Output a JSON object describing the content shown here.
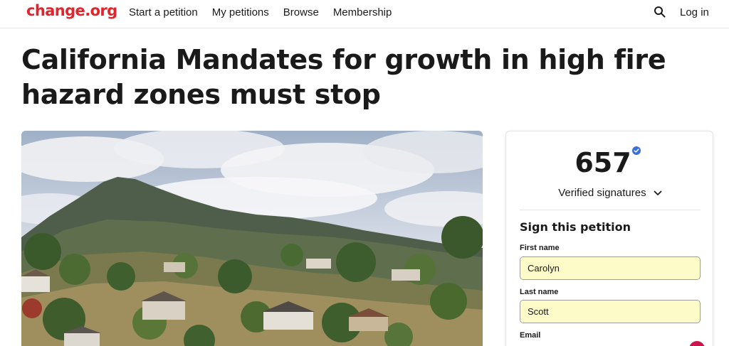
{
  "brand": {
    "logo_text": "change.org",
    "color": "#e0252c"
  },
  "nav": {
    "links": [
      "Start a petition",
      "My petitions",
      "Browse",
      "Membership"
    ],
    "search_icon": "search-icon",
    "login_label": "Log in"
  },
  "petition": {
    "title": "California Mandates for growth in high fire hazard zones must stop"
  },
  "hero_image": {
    "subject": "hillside-houses-photo"
  },
  "signatures": {
    "count": "657",
    "verified_icon": "verified-badge-icon",
    "label": "Verified signatures",
    "accent_color": "#3a6fd8"
  },
  "sign_form": {
    "heading": "Sign this petition",
    "first_name_label": "First name",
    "first_name_value": "Carolyn",
    "last_name_label": "Last name",
    "last_name_value": "Scott",
    "email_label": "Email",
    "autofill_color": "#fdfbc8"
  }
}
